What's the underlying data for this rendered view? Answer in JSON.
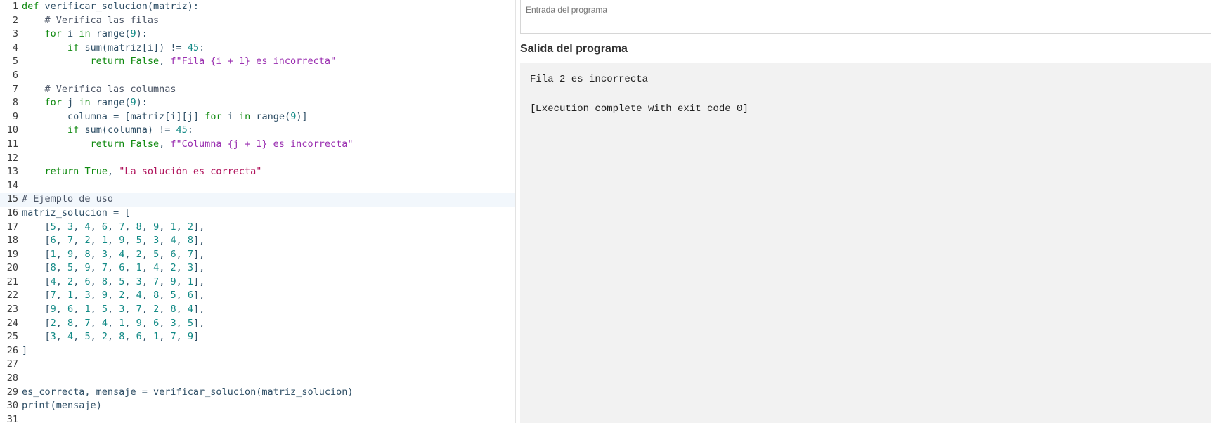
{
  "editor": {
    "line_numbers": [
      "1",
      "2",
      "3",
      "4",
      "5",
      "6",
      "7",
      "8",
      "9",
      "10",
      "11",
      "12",
      "13",
      "14",
      "15",
      "16",
      "17",
      "18",
      "19",
      "20",
      "21",
      "22",
      "23",
      "24",
      "25",
      "26",
      "27",
      "28",
      "29",
      "30",
      "31"
    ],
    "active_line": 15,
    "lines": [
      "def verificar_solucion(matriz):",
      "    # Verifica las filas",
      "    for i in range(9):",
      "        if sum(matriz[i]) != 45:",
      "            return False, f\"Fila {i + 1} es incorrecta\"",
      "",
      "    # Verifica las columnas",
      "    for j in range(9):",
      "        columna = [matriz[i][j] for i in range(9)]",
      "        if sum(columna) != 45:",
      "            return False, f\"Columna {j + 1} es incorrecta\"",
      "",
      "    return True, \"La solución es correcta\"",
      "",
      "# Ejemplo de uso",
      "matriz_solucion = [",
      "    [5, 3, 4, 6, 7, 8, 9, 1, 2],",
      "    [6, 7, 2, 1, 9, 5, 3, 4, 8],",
      "    [1, 9, 8, 3, 4, 2, 5, 6, 7],",
      "    [8, 5, 9, 7, 6, 1, 4, 2, 3],",
      "    [4, 2, 6, 8, 5, 3, 7, 9, 1],",
      "    [7, 1, 3, 9, 2, 4, 8, 5, 6],",
      "    [9, 6, 1, 5, 3, 7, 2, 8, 4],",
      "    [2, 8, 7, 4, 1, 9, 6, 3, 5],",
      "    [3, 4, 5, 2, 8, 6, 1, 7, 9]",
      "]",
      "",
      "",
      "es_correcta, mensaje = verificar_solucion(matriz_solucion)",
      "print(mensaje)",
      ""
    ]
  },
  "input": {
    "placeholder": "Entrada del programa",
    "value": ""
  },
  "output": {
    "title": "Salida del programa",
    "lines": [
      "Fila 2 es incorrecta",
      "",
      "[Execution complete with exit code 0]"
    ]
  },
  "colors": {
    "keyword": "#118a11",
    "number": "#128a86",
    "fstring": "#9a2fb0",
    "string": "#b0145c",
    "comment": "#4b5566",
    "identifier": "#2f4f66",
    "active_line_bg": "#f2f7fc",
    "output_bg": "#f2f2f2"
  }
}
